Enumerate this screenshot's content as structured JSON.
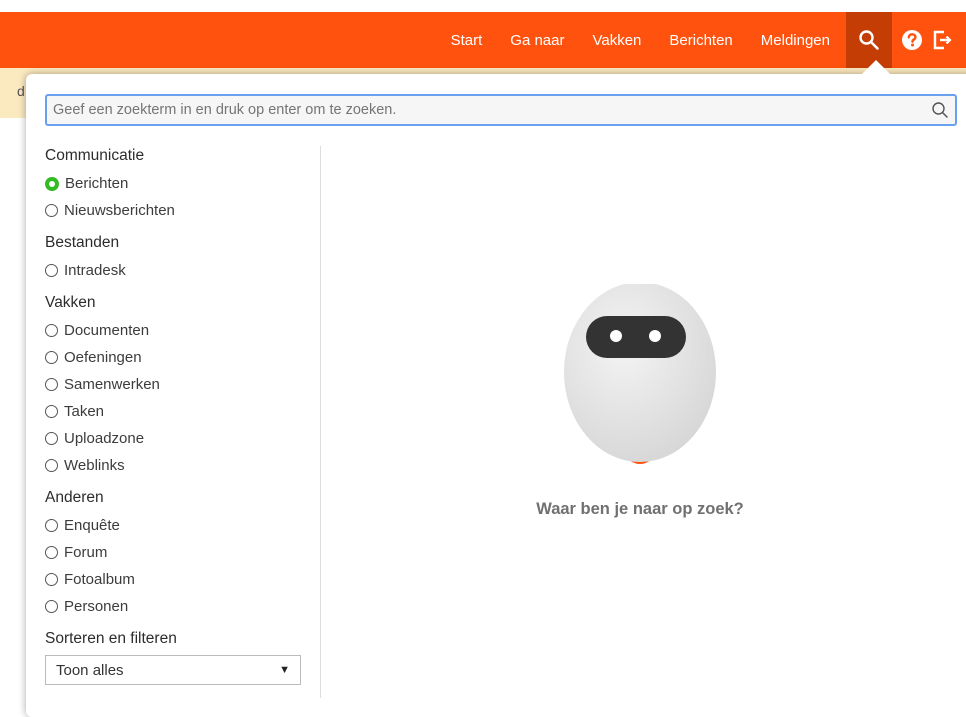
{
  "nav": {
    "items": [
      "Start",
      "Ga naar",
      "Vakken",
      "Berichten",
      "Meldingen"
    ]
  },
  "background": {
    "peek_text": "d"
  },
  "search": {
    "value": "",
    "placeholder": "Geef een zoekterm in en druk op enter om te zoeken."
  },
  "filters": {
    "groups": [
      {
        "title": "Communicatie",
        "options": [
          "Berichten",
          "Nieuwsberichten"
        ]
      },
      {
        "title": "Bestanden",
        "options": [
          "Intradesk"
        ]
      },
      {
        "title": "Vakken",
        "options": [
          "Documenten",
          "Oefeningen",
          "Samenwerken",
          "Taken",
          "Uploadzone",
          "Weblinks"
        ]
      },
      {
        "title": "Anderen",
        "options": [
          "Enquête",
          "Forum",
          "Fotoalbum",
          "Personen"
        ]
      }
    ],
    "selected": "Berichten"
  },
  "sort": {
    "title": "Sorteren en filteren",
    "selected": "Toon alles"
  },
  "empty_state": {
    "message": "Waar ben je naar op zoek?"
  },
  "colors": {
    "brand": "#ff520e",
    "active_tab": "#c43d05",
    "radio_checked": "#33bb22",
    "focus_border": "#6aa0f0"
  },
  "icons": {
    "search": "search-icon",
    "help": "help-icon",
    "logout": "logout-icon"
  }
}
